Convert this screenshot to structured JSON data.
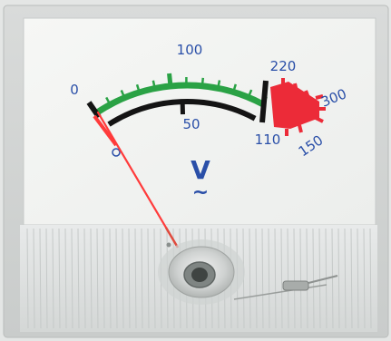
{
  "meter": {
    "unit_symbol": "V",
    "ac_symbol": "~",
    "outer_scale": {
      "labels": [
        "0",
        "100",
        "220",
        "300"
      ]
    },
    "inner_scale": {
      "labels": [
        "50",
        "110",
        "150"
      ]
    },
    "needle_reading_fraction": 0.11,
    "colors": {
      "panel": "#e6e6e6",
      "face": "#f3f4f2",
      "green_arc": "#2aa245",
      "black_arc": "#141414",
      "red_zone": "#ec2b38",
      "numerals": "#2a4fa8",
      "needle": "#ff3b3b"
    }
  }
}
